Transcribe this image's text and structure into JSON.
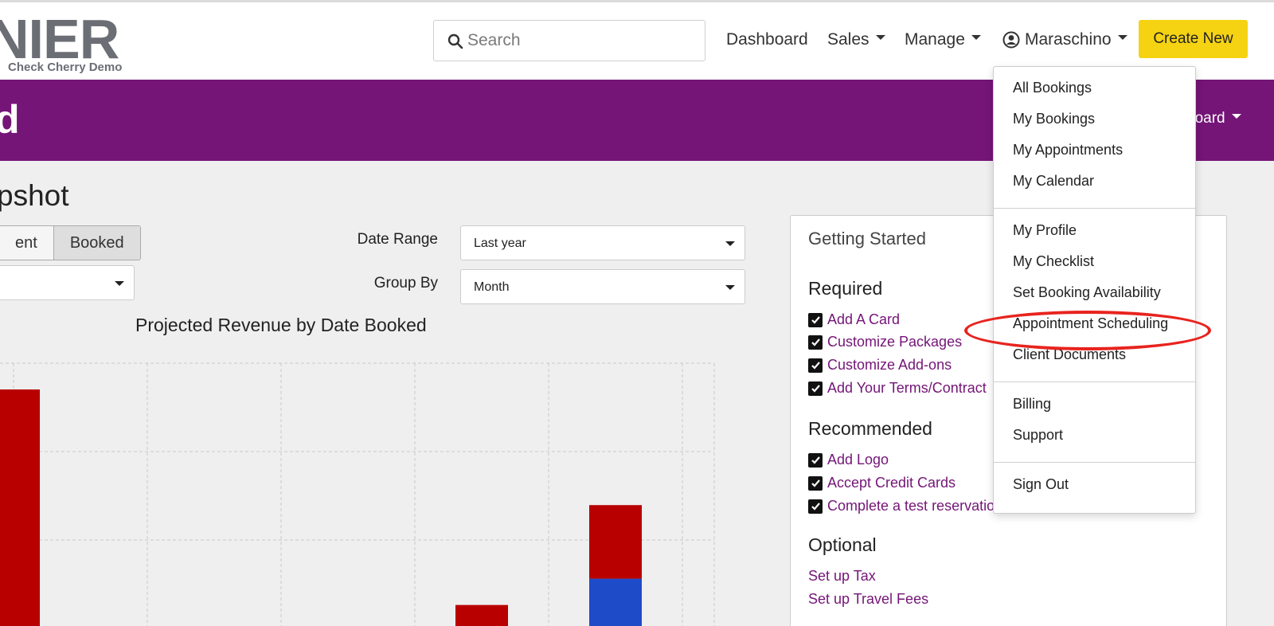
{
  "brand": {
    "logo_text": "NIER",
    "logo_subtitle": "Check Cherry Demo",
    "logo_color": "#6b6e74"
  },
  "header": {
    "search_placeholder": "Search",
    "nav": {
      "dashboard": "Dashboard",
      "sales": "Sales",
      "manage": "Manage",
      "user": "Maraschino"
    },
    "create_new": "Create New"
  },
  "banner": {
    "title_fragment": "d",
    "right_fragment": "board",
    "color": "#741577"
  },
  "snapshot": {
    "title_fragment": "pshot",
    "toggle": {
      "left_fragment": "ent",
      "active": "Booked"
    },
    "date_range": {
      "label": "Date Range",
      "value": "Last year"
    },
    "group_by": {
      "label": "Group By",
      "value": "Month"
    }
  },
  "chart_data": {
    "type": "bar",
    "title": "Projected Revenue by Date Booked",
    "series_colors": [
      "#b80000",
      "#1e4bc8"
    ],
    "grid": true,
    "visible_bars": [
      {
        "position": "leftmost",
        "segments": [
          {
            "color": "#b80000",
            "relative_height": 0.9
          }
        ]
      },
      {
        "position": "center",
        "segments": [
          {
            "color": "#b80000",
            "relative_height": 0.08
          }
        ]
      },
      {
        "position": "right",
        "segments": [
          {
            "color": "#1e4bc8",
            "relative_height": 0.18
          },
          {
            "color": "#b80000",
            "relative_height": 0.28
          }
        ]
      }
    ]
  },
  "getting_started": {
    "title": "Getting Started",
    "required_label": "Required",
    "required": [
      "Add A Card",
      "Customize Packages",
      "Customize Add-ons",
      "Add Your Terms/Contract"
    ],
    "recommended_label": "Recommended",
    "recommended": [
      "Add Logo",
      "Accept Credit Cards",
      "Complete a test reservation"
    ],
    "optional_label": "Optional",
    "optional": [
      "Set up Tax",
      "Set up Travel Fees"
    ]
  },
  "user_menu": {
    "group1": [
      "All Bookings",
      "My Bookings",
      "My Appointments",
      "My Calendar"
    ],
    "group2": [
      "My Profile",
      "My Checklist",
      "Set Booking Availability",
      "Appointment Scheduling",
      "Client Documents"
    ],
    "group3": [
      "Billing",
      "Support"
    ],
    "group4": [
      "Sign Out"
    ],
    "highlighted": "Appointment Scheduling",
    "highlight_color": "#e8231e"
  }
}
